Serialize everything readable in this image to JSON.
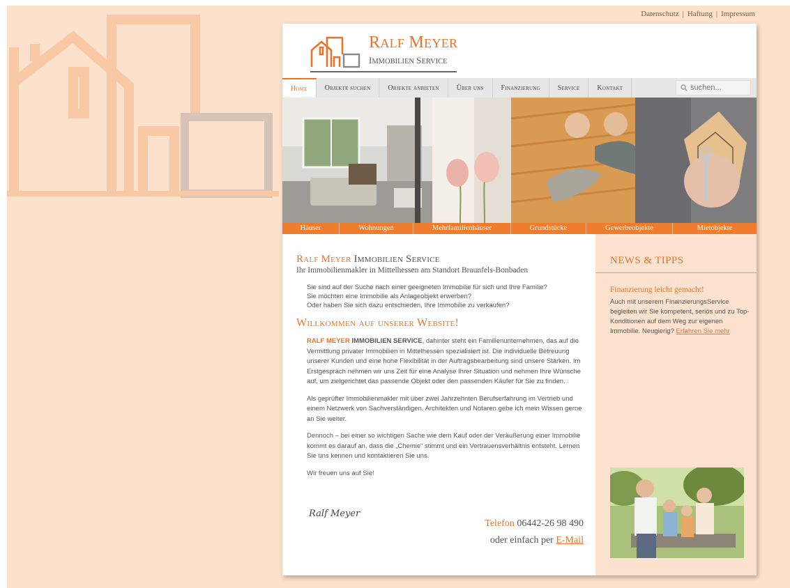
{
  "top_links": [
    "Datenschutz",
    "Haftung",
    "Impressum"
  ],
  "logo": {
    "brand_first": "R",
    "brand_first_rest": "ALF",
    "brand_second": "M",
    "brand_second_rest": "EYER",
    "sub_a": "I",
    "sub_a_rest": "MMOBILIEN",
    "sub_b": "S",
    "sub_b_rest": "ERVICE"
  },
  "nav": {
    "items": [
      "Home",
      "Objekte suchen",
      "Objekte anbieten",
      "Über uns",
      "Finanzierung",
      "Service",
      "Kontakt"
    ],
    "search_placeholder": "suchen..."
  },
  "categories": [
    "Häuser",
    "Wohnungen",
    "Mehrfamilienhäuser",
    "Grundstücke",
    "Gewerbeobjekte",
    "Mietobjekte"
  ],
  "main": {
    "title_orange": "Ralf Meyer",
    "title_grey": "Immobilien Service",
    "tagline": "Ihr Immobilienmakler in Mittelhessen am Standort Braunfels-Bonbaden",
    "intro": [
      "Sie sind auf der Suche nach einer geeigneten Immobilie für sich und Ihre Familie?",
      "Sie möchten eine Immobilie als Anlageobjekt erwerben?",
      "Oder haben Sie sich dazu entschieden, Ihre Immobilie zu verkaufen?"
    ],
    "welcome": "Willkommen auf unserer Website!",
    "p1_strong1": "RALF MEYER",
    "p1_strong2": "IMMOBILIEN SERVICE",
    "p1_rest": ", dahinter steht ein Familienunternehmen, das auf die Vermittlung privater Immobilien in Mittelhessen spezialisiert ist. Die individuelle Betreuung unserer Kunden und eine hohe Flexibilität in der Auftragsbearbeitung sind unsere Stärken. Im Erstgespräch nehmen wir uns Zeit für eine Analyse Ihrer Situation und nehmen Ihre Wünsche auf, um zielgerichtet das passende Objekt oder den passenden Käufer für Sie zu finden.",
    "p2": "Als geprüfter Immobilienmakler mit über zwei Jahrzehnten Berufserfahrung im Vertrieb und einem Netzwerk von Sachverständigen, Architekten und Notaren gebe ich mein Wissen gerne an Sie weiter.",
    "p3": "Dennoch – bei einer so wichtigen Sache wie dem Kauf oder der Veräußerung einer Immobilie kommt es darauf an, dass die „Chemie“ stimmt und ein Vertrauensverhältnis entsteht. Lernen Sie uns kennen und kontaktieren Sie uns.",
    "p4": "Wir freuen uns auf Sie!",
    "signature": "Ralf Meyer",
    "phone_label": "Telefon",
    "phone": "06442-26 98 490",
    "email_prefix": "oder einfach per",
    "email_link": "E-Mail"
  },
  "sidebar": {
    "title": "NEWS & TIPPS",
    "news_head": "Finanzierung leicht gemacht!",
    "news_text": "Auch mit unserem FinanzierungsService begleiten wir Sie kompetent, seriös und zu Top-Konditionen auf dem Weg zur eigenen Immobilie. Neugierig?",
    "news_more": "Erfahren Sie mehr"
  },
  "colors": {
    "accent": "#e8732b",
    "category_bar": "#ef7d2d",
    "background": "#fce1cd",
    "sidebar": "#fde3cf"
  },
  "icons": {
    "search": "search-icon"
  }
}
